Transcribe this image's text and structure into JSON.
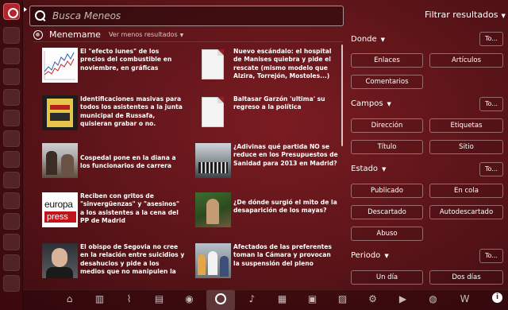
{
  "search": {
    "placeholder": "Busca Meneos",
    "value": ""
  },
  "filter": {
    "title": "Filtrar resultados",
    "sections": [
      {
        "name": "Donde",
        "all_label": "To...",
        "options": [
          "Enlaces",
          "Artículos",
          "Comentarios"
        ]
      },
      {
        "name": "Campos",
        "all_label": "To...",
        "options": [
          "Dirección",
          "Etiquetas",
          "Título",
          "Sitio"
        ]
      },
      {
        "name": "Estado",
        "all_label": "To...",
        "options": [
          "Publicado",
          "En cola",
          "Descartado",
          "Autodescartado",
          "Abuso"
        ]
      },
      {
        "name": "Periodo",
        "all_label": "To...",
        "options": [
          "Un día",
          "Dos días"
        ]
      }
    ]
  },
  "results": {
    "group_name": "Menemame",
    "more_label": "Ver menos resultados",
    "items": [
      {
        "text": "El \"efecto lunes\" de los precios del combustible en noviembre, en gráficas",
        "thumb": "chart"
      },
      {
        "text": "Nuevo escándalo: el hospital de Manises quiebra y pide el rescate (mismo modelo que Alzira, Torrejón, Mostoles...)",
        "thumb": "document"
      },
      {
        "text": "Identificaciones masivas para todos los asistentes a la junta municipal de Russafa, quisieran grabar o no.",
        "thumb": "poster"
      },
      {
        "text": "Baltasar Garzón 'ultima' su regreso a la política",
        "thumb": "document"
      },
      {
        "text": "Cospedal pone en la diana a los funcionarios de carrera",
        "thumb": "photo"
      },
      {
        "text": "¿Adivinas qué partida NO se reduce en los Presupuestos de Sanidad para 2013 en Madrid?",
        "thumb": "photo"
      },
      {
        "text": "Reciben con gritos de \"sinvergüenzas\" y \"asesinos\" a los asistentes a la cena del PP de Madrid",
        "thumb": "logo",
        "logo_top": "europa",
        "logo_bottom": "press"
      },
      {
        "text": "¿De dónde surgió el mito de la desaparición de los mayas?",
        "thumb": "photo"
      },
      {
        "text": "El obispo de Segovia no cree en la relación entre suicidios y desahucios y pide a los medios que no manipulen la",
        "thumb": "photo"
      },
      {
        "text": "Afectados de las preferentes toman la Cámara y provocan la suspensión del pleno",
        "thumb": "photo"
      }
    ]
  },
  "dock": {
    "icons": [
      "home-icon",
      "applications-icon",
      "files-icon",
      "document-icon",
      "music-icon",
      "reference-icon",
      "menemame-icon",
      "music-note-icon",
      "books-icon",
      "photos-icon",
      "radio-icon",
      "shopping-icon",
      "video-icon",
      "web-icon",
      "wikipedia-icon",
      "info-icon"
    ],
    "glyphs": [
      "⌂",
      "▥",
      "⌇",
      "▤",
      "◉",
      "◔",
      "",
      "♪",
      "▦",
      "▣",
      "▨",
      "⚙",
      "▶",
      "◍",
      "W",
      "i"
    ]
  },
  "colors": {
    "accent": "#b4242c",
    "background": "#5e1418"
  }
}
